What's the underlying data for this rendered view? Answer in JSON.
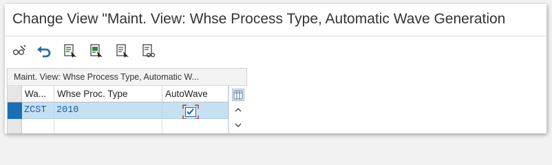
{
  "window": {
    "title": "Change View \"Maint. View: Whse Process Type, Automatic Wave Generation"
  },
  "toolbar": {
    "buttons": [
      {
        "name": "display-change-button",
        "icon": "glasses-pencil-icon"
      },
      {
        "name": "undo-button",
        "icon": "undo-icon"
      },
      {
        "name": "select-all-button",
        "icon": "select-all-icon"
      },
      {
        "name": "select-block-button",
        "icon": "select-block-icon"
      },
      {
        "name": "deselect-all-button",
        "icon": "deselect-all-icon"
      },
      {
        "name": "print-preview-button",
        "icon": "print-view-icon"
      }
    ]
  },
  "table": {
    "title": "Maint. View: Whse Process Type, Automatic W...",
    "columns": [
      "Wa...",
      "Whse Proc. Type",
      "AutoWave"
    ],
    "rows": [
      {
        "wa": "ZCST",
        "proc_type": "2010",
        "autowave": true
      }
    ]
  },
  "colors": {
    "accent": "#1a6fb5",
    "selected_row": "#c5e0f3",
    "value_text": "#1a5fa6"
  }
}
